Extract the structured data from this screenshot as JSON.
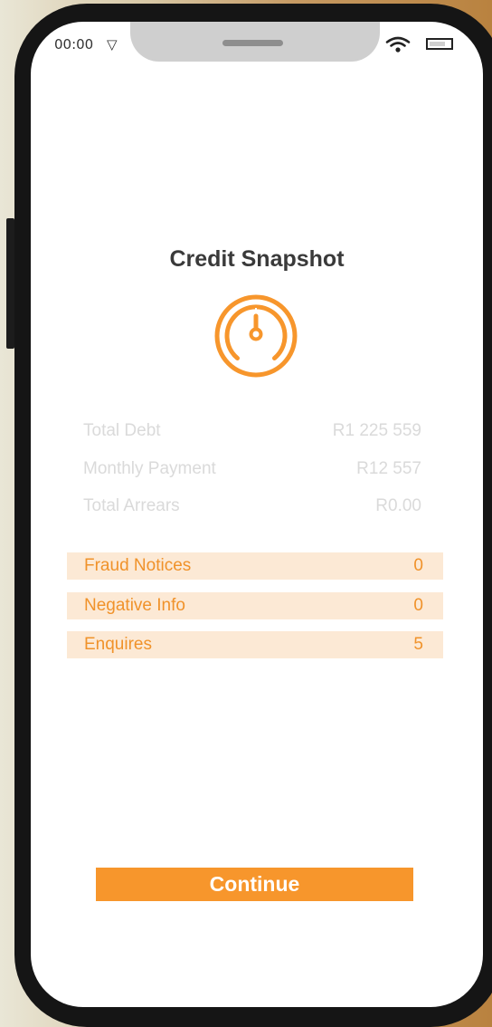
{
  "status_bar": {
    "time": "00:00",
    "nav_glyph": "▽",
    "wifi_icon": "wifi-icon",
    "battery_icon": "battery-icon"
  },
  "screen": {
    "title": "Credit Snapshot",
    "icon": "speedometer-icon",
    "accent_color": "#f7962c"
  },
  "summary": [
    {
      "label": "Total Debt",
      "value": "R1 225 559"
    },
    {
      "label": "Monthly Payment",
      "value": "R12 557"
    },
    {
      "label": "Total Arrears",
      "value": "R0.00"
    }
  ],
  "alerts": [
    {
      "label": "Fraud Notices",
      "value": "0"
    },
    {
      "label": "Negative Info",
      "value": "0"
    },
    {
      "label": "Enquires",
      "value": "5"
    }
  ],
  "actions": {
    "continue_label": "Continue"
  }
}
